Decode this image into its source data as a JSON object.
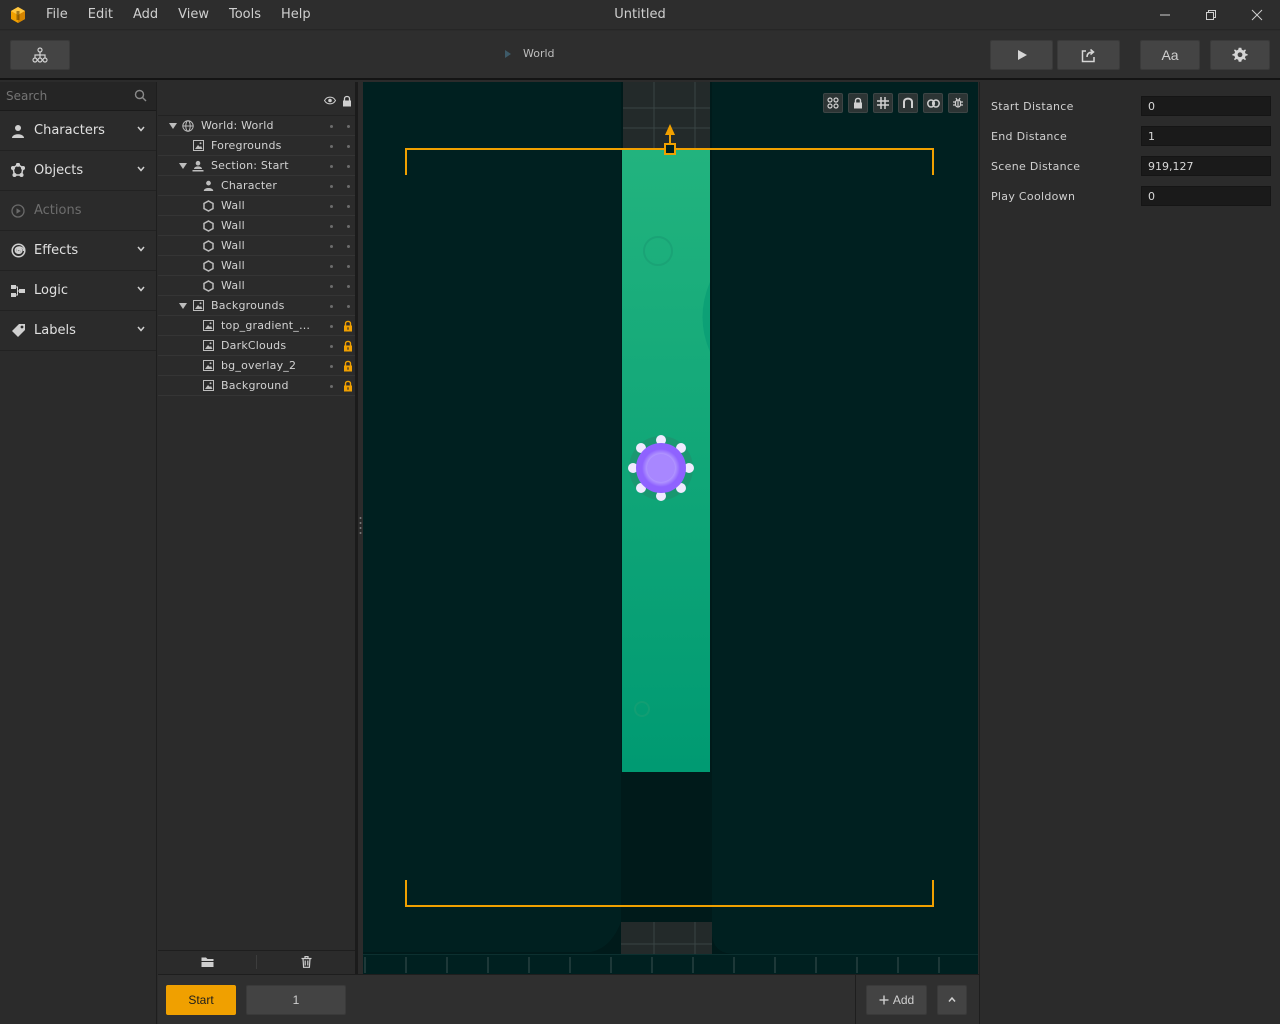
{
  "app": {
    "title": "Untitled",
    "menu": [
      "File",
      "Edit",
      "Add",
      "View",
      "Tools",
      "Help"
    ]
  },
  "toolbar": {
    "breadcrumb": "World",
    "font_button_label": "Aa"
  },
  "left_panel": {
    "search_placeholder": "Search",
    "categories": [
      {
        "label": "Characters",
        "icon": "person-icon",
        "enabled": true
      },
      {
        "label": "Objects",
        "icon": "objects-icon",
        "enabled": true
      },
      {
        "label": "Actions",
        "icon": "play-circle-icon",
        "enabled": false
      },
      {
        "label": "Effects",
        "icon": "swirl-icon",
        "enabled": true
      },
      {
        "label": "Logic",
        "icon": "logic-icon",
        "enabled": true
      },
      {
        "label": "Labels",
        "icon": "tag-icon",
        "enabled": true
      }
    ]
  },
  "hierarchy": {
    "rows": [
      {
        "label": "World: World",
        "icon": "globe-icon",
        "expanded": true,
        "locked": false
      },
      {
        "label": "Foregrounds",
        "icon": "image-icon",
        "expanded": null,
        "locked": false
      },
      {
        "label": "Section: Start",
        "icon": "section-icon",
        "expanded": true,
        "locked": false
      },
      {
        "label": "Character",
        "icon": "person-icon",
        "expanded": null,
        "locked": false
      },
      {
        "label": "Wall",
        "icon": "hexagon-icon",
        "expanded": null,
        "locked": false
      },
      {
        "label": "Wall",
        "icon": "hexagon-icon",
        "expanded": null,
        "locked": false
      },
      {
        "label": "Wall",
        "icon": "hexagon-icon",
        "expanded": null,
        "locked": false
      },
      {
        "label": "Wall",
        "icon": "hexagon-icon",
        "expanded": null,
        "locked": false
      },
      {
        "label": "Wall",
        "icon": "hexagon-icon",
        "expanded": null,
        "locked": false
      },
      {
        "label": "Backgrounds",
        "icon": "image-icon",
        "expanded": true,
        "locked": false
      },
      {
        "label": "top_gradient_m···",
        "icon": "image-icon",
        "expanded": null,
        "locked": true
      },
      {
        "label": "DarkClouds",
        "icon": "image-icon",
        "expanded": null,
        "locked": true
      },
      {
        "label": "bg_overlay_2",
        "icon": "image-icon",
        "expanded": null,
        "locked": true
      },
      {
        "label": "Background",
        "icon": "image-icon",
        "expanded": null,
        "locked": true
      }
    ]
  },
  "inspector": {
    "properties": [
      {
        "label": "Start Distance",
        "value": "0"
      },
      {
        "label": "End Distance",
        "value": "1"
      },
      {
        "label": "Scene Distance",
        "value": "919,127"
      },
      {
        "label": "Play Cooldown",
        "value": "0"
      }
    ]
  },
  "sections": {
    "start_label": "Start",
    "second_label": "1",
    "add_label": "Add"
  },
  "colors": {
    "accent": "#f0a000",
    "viewport_bg": "#001a1a",
    "track_top": "#22b37e",
    "track_bottom": "#009a72",
    "character": "#9a6cff"
  }
}
